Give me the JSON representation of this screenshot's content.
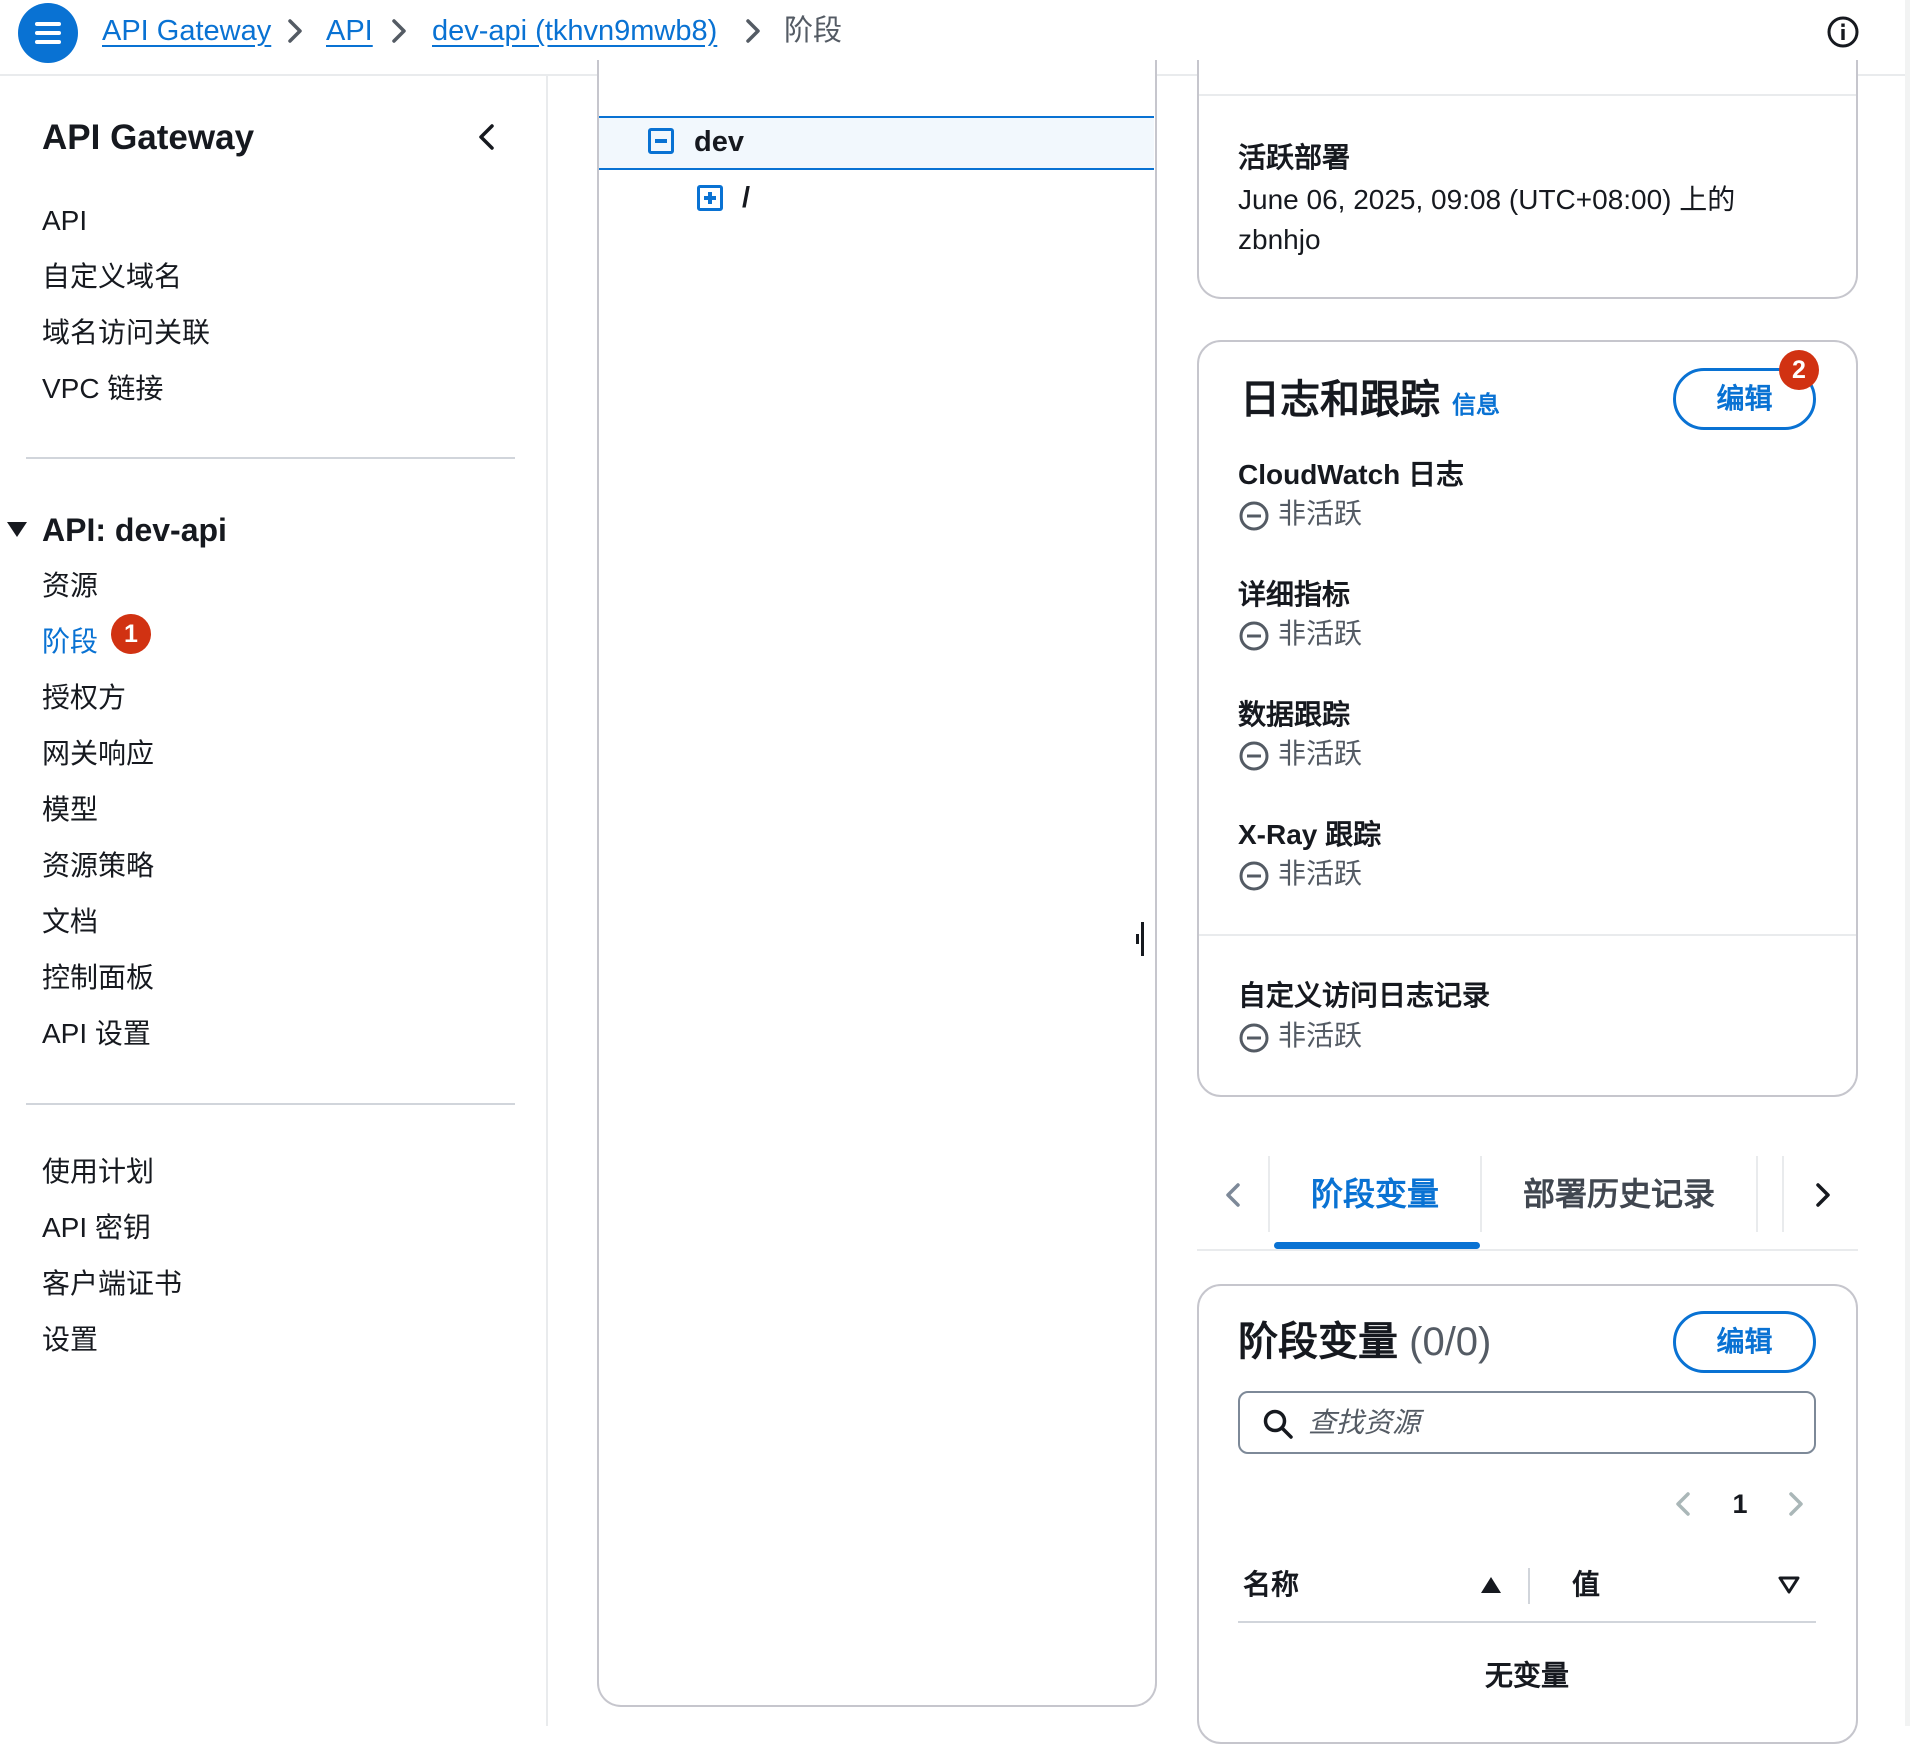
{
  "breadcrumbs": [
    {
      "label": "API Gateway"
    },
    {
      "label": "API"
    },
    {
      "label": "dev-api (tkhvn9mwb8)"
    },
    {
      "label": "阶段"
    }
  ],
  "sidebar": {
    "title": "API Gateway",
    "top_items": [
      {
        "label": "API"
      },
      {
        "label": "自定义域名"
      },
      {
        "label": "域名访问关联"
      },
      {
        "label": "VPC 链接"
      }
    ],
    "api_section": {
      "title": "API: dev-api",
      "items": [
        {
          "label": "资源"
        },
        {
          "label": "阶段",
          "active": true,
          "badge": "1"
        },
        {
          "label": "授权方"
        },
        {
          "label": "网关响应"
        },
        {
          "label": "模型"
        },
        {
          "label": "资源策略"
        },
        {
          "label": "文档"
        },
        {
          "label": "控制面板"
        },
        {
          "label": "API 设置"
        }
      ]
    },
    "bottom_items": [
      {
        "label": "使用计划"
      },
      {
        "label": "API 密钥"
      },
      {
        "label": "客户端证书"
      },
      {
        "label": "设置"
      }
    ]
  },
  "stage_tree": {
    "stage": {
      "label": "dev",
      "expanded": true
    },
    "resource": {
      "label": "/",
      "expanded": false
    }
  },
  "active_deployment": {
    "label": "活跃部署",
    "value": "June 06, 2025, 09:08 (UTC+08:00) 上的 zbnhjo"
  },
  "logs_tracing": {
    "title": "日志和跟踪",
    "info_link": "信息",
    "edit_label": "编辑",
    "edit_badge": "2",
    "fields": [
      {
        "label": "CloudWatch 日志",
        "status": "非活跃"
      },
      {
        "label": "详细指标",
        "status": "非活跃"
      },
      {
        "label": "数据跟踪",
        "status": "非活跃"
      },
      {
        "label": "X-Ray 跟踪",
        "status": "非活跃"
      }
    ],
    "custom_access_log": {
      "label": "自定义访问日志记录",
      "status": "非活跃"
    }
  },
  "tabs": [
    {
      "label": "阶段变量",
      "selected": true
    },
    {
      "label": "部署历史记录",
      "selected": false
    }
  ],
  "stage_variables": {
    "title": "阶段变量",
    "count": "(0/0)",
    "edit_label": "编辑",
    "search_placeholder": "查找资源",
    "search_value": "",
    "page": "1",
    "columns": [
      {
        "label": "名称",
        "sort": "ascending"
      },
      {
        "label": "值",
        "sort": "none"
      }
    ],
    "empty_text": "无变量"
  },
  "colors": {
    "accent": "#0972d3",
    "badge": "#d13212",
    "border": "#c6c6cd",
    "muted_text": "#545b64"
  },
  "icons": [
    "menu-icon",
    "chevron-right-icon",
    "info-circle-icon",
    "chevron-left-icon",
    "caret-down-icon",
    "tree-collapse-icon",
    "tree-expand-icon",
    "status-negative-icon",
    "search-icon",
    "sort-ascending-icon",
    "sort-descending-icon"
  ]
}
